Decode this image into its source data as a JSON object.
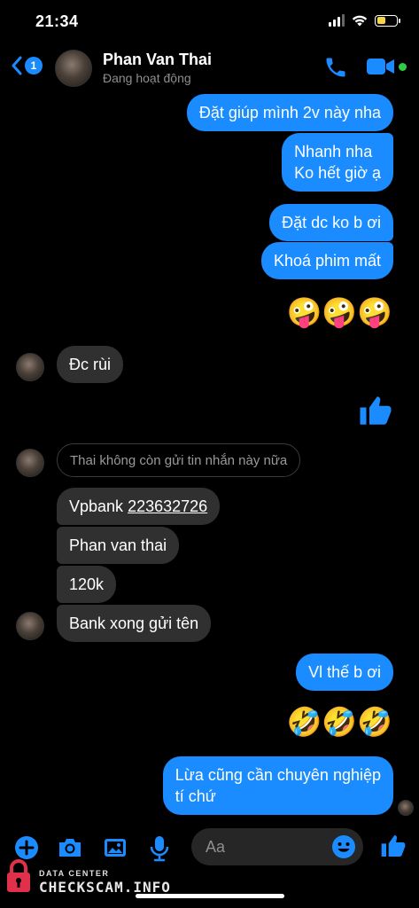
{
  "status_bar": {
    "time": "21:34",
    "battery_percent": 45
  },
  "header": {
    "back_badge": "1",
    "contact_name": "Phan Van Thai",
    "contact_status": "Đang hoạt động",
    "icons": [
      "chevron-left-icon",
      "phone-icon",
      "video-camera-icon"
    ],
    "online_color": "#31cc46"
  },
  "messages": {
    "out_1": "Đặt giúp mình 2v này nha",
    "out_2_line1": "Nhanh nha",
    "out_2_line2": "Ko hết giờ ạ",
    "out_3": "Đặt dc ko b ơi",
    "out_4": "Khoá phim mất",
    "emoji_1": "🤪🤪🤪",
    "in_1": "Đc rùi",
    "unsent_notice": "Thai không còn gửi tin nhắn này nữa",
    "in_2_prefix": "Vpbank ",
    "in_2_account": "223632726",
    "in_3": "Phan van thai",
    "in_4": "120k",
    "in_5": "Bank xong gửi tên",
    "out_5": "Vl thế b ơi",
    "emoji_2": "🤣🤣🤣",
    "out_6_line1": "Lừa cũng cần chuyên nghiệp",
    "out_6_line2": "tí chứ"
  },
  "composer": {
    "placeholder": "Aa",
    "icons": [
      "plus-icon",
      "camera-icon",
      "image-icon",
      "microphone-icon",
      "smile-icon",
      "thumbs-up-icon"
    ]
  },
  "watermark": {
    "line1": "DATA CENTER",
    "line2": "CHECKSCAM.INFO"
  },
  "colors": {
    "accent": "#1a8cff",
    "incoming_bubble": "#303030",
    "background": "#000000"
  }
}
